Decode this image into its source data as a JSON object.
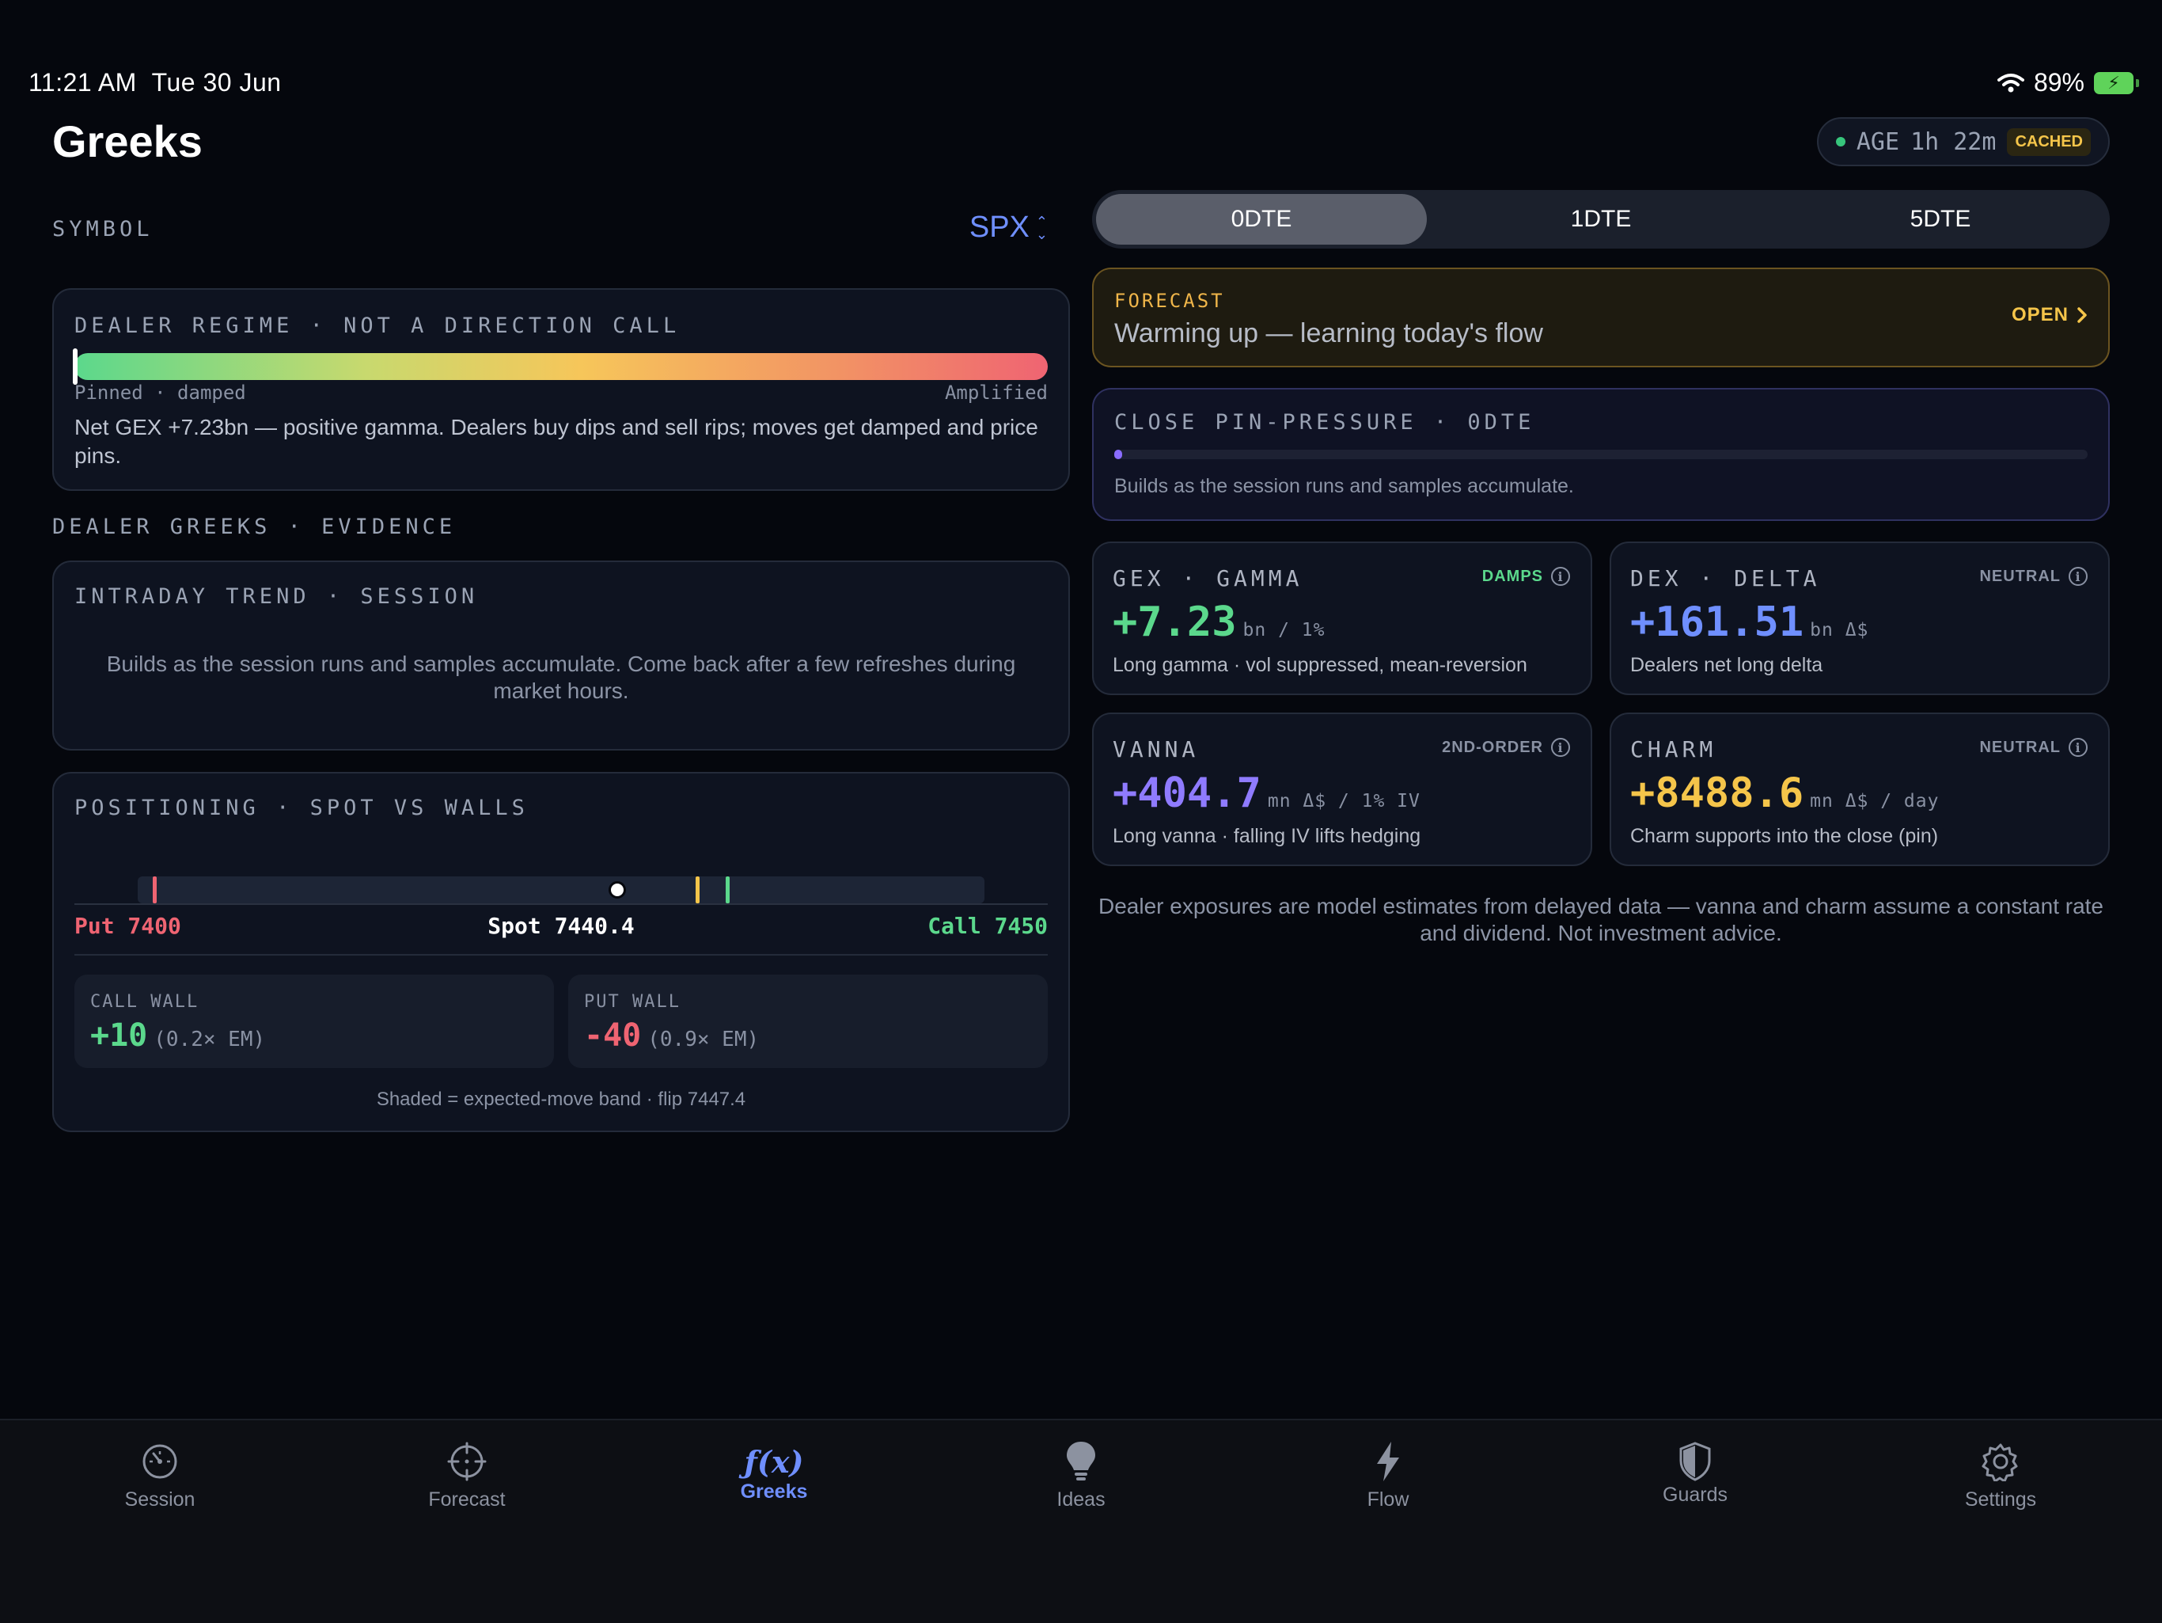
{
  "status_bar": {
    "time": "11:21 AM",
    "date": "Tue 30 Jun",
    "battery": "89%"
  },
  "page": {
    "title": "Greeks"
  },
  "age": {
    "label": "AGE",
    "value": "1h 22m",
    "badge": "CACHED"
  },
  "symbol": {
    "label": "SYMBOL",
    "value": "SPX"
  },
  "regime": {
    "title": "DEALER REGIME · NOT A DIRECTION CALL",
    "left_label": "Pinned · damped",
    "right_label": "Amplified",
    "description": "Net GEX +7.23bn — positive gamma. Dealers buy dips and sell rips; moves get damped and price pins.",
    "position_fraction": 0.0
  },
  "evidence_label": "DEALER GREEKS · EVIDENCE",
  "trend": {
    "title": "INTRADAY TREND · SESSION",
    "message": "Builds as the session runs and samples accumulate. Come back after a few refreshes during market hours."
  },
  "positioning": {
    "title": "POSITIONING · SPOT VS WALLS",
    "put_label": "Put 7400",
    "spot_label": "Spot 7440.4",
    "call_label": "Call 7450",
    "put_strike": 7400,
    "spot": 7440.4,
    "call_strike": 7450,
    "flip": 7447.4,
    "call_wall": {
      "title": "CALL WALL",
      "value": "+10",
      "sub": "(0.2× EM)"
    },
    "put_wall": {
      "title": "PUT WALL",
      "value": "-40",
      "sub": "(0.9× EM)"
    },
    "footnote": "Shaded = expected-move band · flip 7447.4"
  },
  "dte_tabs": [
    {
      "label": "0DTE",
      "selected": true
    },
    {
      "label": "1DTE",
      "selected": false
    },
    {
      "label": "5DTE",
      "selected": false
    }
  ],
  "forecast": {
    "kicker": "FORECAST",
    "message": "Warming up — learning today's flow",
    "action": "OPEN"
  },
  "pin_pressure": {
    "title": "CLOSE PIN-PRESSURE · 0DTE",
    "message": "Builds as the session runs and samples accumulate.",
    "fill_fraction": 0.005
  },
  "metrics": {
    "gex": {
      "name": "GEX · GAMMA",
      "tag": "DAMPS",
      "value": "+7.23",
      "unit": "bn / 1%",
      "desc": "Long gamma · vol suppressed, mean-reversion"
    },
    "dex": {
      "name": "DEX · DELTA",
      "tag": "NEUTRAL",
      "value": "+161.51",
      "unit": "bn Δ$",
      "desc": "Dealers net long delta"
    },
    "vanna": {
      "name": "VANNA",
      "tag": "2ND-ORDER",
      "value": "+404.7",
      "unit": "mn Δ$ / 1% IV",
      "desc": "Long vanna · falling IV lifts hedging"
    },
    "charm": {
      "name": "CHARM",
      "tag": "NEUTRAL",
      "value": "+8488.6",
      "unit": "mn Δ$ / day",
      "desc": "Charm supports into the close (pin)"
    }
  },
  "disclaimer": "Dealer exposures are model estimates from delayed data — vanna and charm assume a constant rate and dividend. Not investment advice.",
  "tabbar": [
    {
      "label": "Session",
      "icon": "gauge-icon"
    },
    {
      "label": "Forecast",
      "icon": "crosshair-icon"
    },
    {
      "label": "Greeks",
      "icon": "function-icon",
      "active": true
    },
    {
      "label": "Ideas",
      "icon": "lightbulb-icon"
    },
    {
      "label": "Flow",
      "icon": "bolt-icon"
    },
    {
      "label": "Guards",
      "icon": "shield-icon"
    },
    {
      "label": "Settings",
      "icon": "gear-icon"
    }
  ],
  "colors": {
    "accent": "#6f8fff",
    "green": "#5bd88c",
    "red": "#ef6472",
    "amber": "#f5c54a",
    "purple": "#8a6cff"
  }
}
